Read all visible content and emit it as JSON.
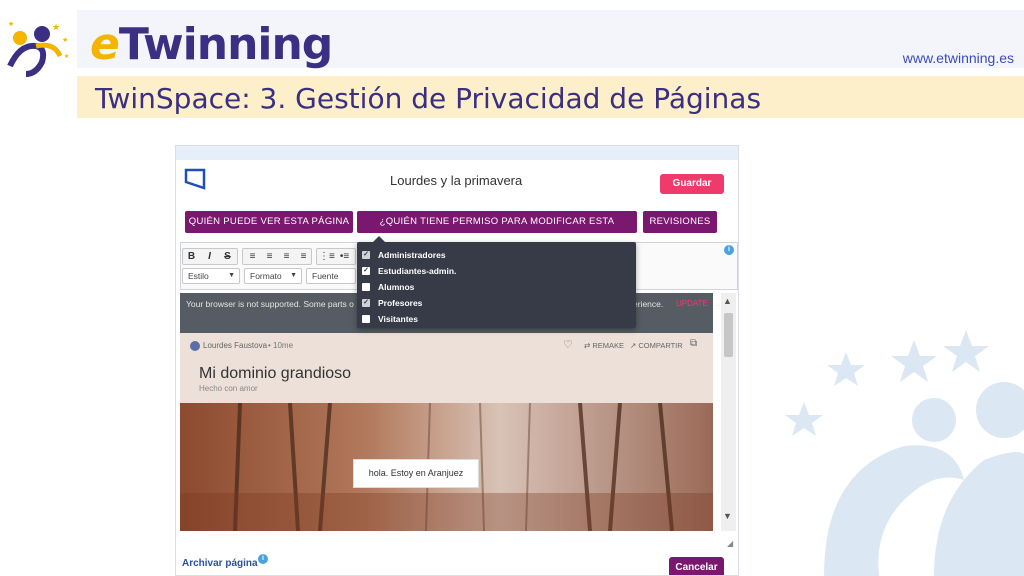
{
  "slide": {
    "brand_e": "e",
    "brand_rest": "Twinning",
    "site_url": "www.etwinning.es",
    "title": "TwinSpace: 3. Gestión de Privacidad de Páginas"
  },
  "app": {
    "page_name": "Lourdes y la primavera",
    "save_label": "Guardar",
    "tabs": [
      {
        "label": "QUIÉN PUEDE VER ESTA PÁGINA"
      },
      {
        "label": "¿QUIÉN TIENE PERMISO PARA MODIFICAR ESTA PÁGINA?"
      },
      {
        "label": "REVISIONES"
      }
    ],
    "toolbar": {
      "bold": "B",
      "italic": "I",
      "strike": "S",
      "selects": [
        {
          "label": "Estilo"
        },
        {
          "label": "Formato"
        },
        {
          "label": "Fuente"
        }
      ]
    },
    "notice": {
      "text": "Your browser is not supported. Some parts o",
      "tail": "erience.",
      "update": "UPDATE"
    },
    "post": {
      "author": "Lourdes Faustova",
      "time": "• 10me",
      "remake": "REMAKE",
      "share": "COMPARTIR",
      "title": "Mi dominio grandioso",
      "subtitle": "Hecho con amor",
      "caption": "hola. Estoy en Aranjuez"
    },
    "archive_label": "Archivar página",
    "cancel_label": "Cancelar",
    "dropdown": [
      {
        "label": "Administradores",
        "checked": true
      },
      {
        "label": "Estudiantes-admin.",
        "checked": true
      },
      {
        "label": "Alumnos",
        "checked": false
      },
      {
        "label": "Profesores",
        "checked": true
      },
      {
        "label": "Visitantes",
        "checked": false
      }
    ]
  },
  "colors": {
    "brand_purple": "#3a2f83",
    "brand_yellow": "#f4b400",
    "tab_purple": "#7a176f",
    "save_pink": "#ef3b6c"
  }
}
